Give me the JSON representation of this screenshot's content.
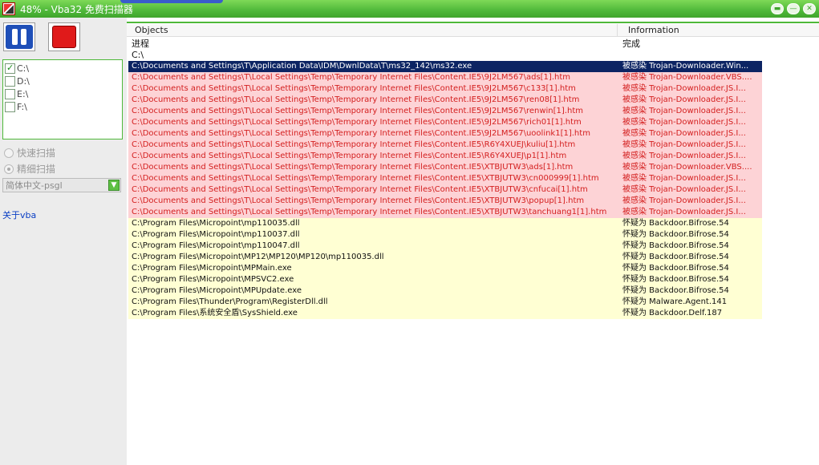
{
  "window": {
    "title": "48% - Vba32 免费扫描器"
  },
  "left": {
    "drives": [
      {
        "label": "C:\\",
        "checked": true
      },
      {
        "label": "D:\\",
        "checked": false
      },
      {
        "label": "E:\\",
        "checked": false
      },
      {
        "label": "F:\\",
        "checked": false
      }
    ],
    "quick_scan": "快速扫描",
    "deep_scan": "精细扫描",
    "language": "简体中文-psgl",
    "about": "关于vba"
  },
  "table": {
    "col_objects": "Objects",
    "col_info": "Information",
    "rows": [
      {
        "type": "plain",
        "object": "进程",
        "info": "完成"
      },
      {
        "type": "plain",
        "object": "C:\\",
        "info": ""
      },
      {
        "type": "selected",
        "object": "C:\\Documents and Settings\\T\\Application Data\\IDM\\DwnlData\\T\\ms32_142\\ms32.exe",
        "info": "被感染 Trojan-Downloader.Win..."
      },
      {
        "type": "infected",
        "object": "C:\\Documents and Settings\\T\\Local Settings\\Temp\\Temporary Internet Files\\Content.IE5\\9J2LM567\\ads[1].htm",
        "info": "被感染 Trojan-Downloader.VBS...."
      },
      {
        "type": "infected",
        "object": "C:\\Documents and Settings\\T\\Local Settings\\Temp\\Temporary Internet Files\\Content.IE5\\9J2LM567\\c133[1].htm",
        "info": "被感染 Trojan-Downloader.JS.I..."
      },
      {
        "type": "infected",
        "object": "C:\\Documents and Settings\\T\\Local Settings\\Temp\\Temporary Internet Files\\Content.IE5\\9J2LM567\\ren08[1].htm",
        "info": "被感染 Trojan-Downloader.JS.I..."
      },
      {
        "type": "infected",
        "object": "C:\\Documents and Settings\\T\\Local Settings\\Temp\\Temporary Internet Files\\Content.IE5\\9J2LM567\\renwin[1].htm",
        "info": "被感染 Trojan-Downloader.JS.I..."
      },
      {
        "type": "infected",
        "object": "C:\\Documents and Settings\\T\\Local Settings\\Temp\\Temporary Internet Files\\Content.IE5\\9J2LM567\\rich01[1].htm",
        "info": "被感染 Trojan-Downloader.JS.I..."
      },
      {
        "type": "infected",
        "object": "C:\\Documents and Settings\\T\\Local Settings\\Temp\\Temporary Internet Files\\Content.IE5\\9J2LM567\\uoolink1[1].htm",
        "info": "被感染 Trojan-Downloader.JS.I..."
      },
      {
        "type": "infected",
        "object": "C:\\Documents and Settings\\T\\Local Settings\\Temp\\Temporary Internet Files\\Content.IE5\\R6Y4XUEJ\\kuliu[1].htm",
        "info": "被感染 Trojan-Downloader.JS.I..."
      },
      {
        "type": "infected",
        "object": "C:\\Documents and Settings\\T\\Local Settings\\Temp\\Temporary Internet Files\\Content.IE5\\R6Y4XUEJ\\p1[1].htm",
        "info": "被感染 Trojan-Downloader.JS.I..."
      },
      {
        "type": "infected",
        "object": "C:\\Documents and Settings\\T\\Local Settings\\Temp\\Temporary Internet Files\\Content.IE5\\XTBJUTW3\\ads[1].htm",
        "info": "被感染 Trojan-Downloader.VBS...."
      },
      {
        "type": "infected",
        "object": "C:\\Documents and Settings\\T\\Local Settings\\Temp\\Temporary Internet Files\\Content.IE5\\XTBJUTW3\\cn000999[1].htm",
        "info": "被感染 Trojan-Downloader.JS.I..."
      },
      {
        "type": "infected",
        "object": "C:\\Documents and Settings\\T\\Local Settings\\Temp\\Temporary Internet Files\\Content.IE5\\XTBJUTW3\\cnfucai[1].htm",
        "info": "被感染 Trojan-Downloader.JS.I..."
      },
      {
        "type": "infected",
        "object": "C:\\Documents and Settings\\T\\Local Settings\\Temp\\Temporary Internet Files\\Content.IE5\\XTBJUTW3\\popup[1].htm",
        "info": "被感染 Trojan-Downloader.JS.I..."
      },
      {
        "type": "infected",
        "object": "C:\\Documents and Settings\\T\\Local Settings\\Temp\\Temporary Internet Files\\Content.IE5\\XTBJUTW3\\tanchuang1[1].htm",
        "info": "被感染 Trojan-Downloader.JS.I..."
      },
      {
        "type": "suspect",
        "object": "C:\\Program Files\\Micropoint\\mp110035.dll",
        "info": "怀疑为 Backdoor.Bifrose.54"
      },
      {
        "type": "suspect",
        "object": "C:\\Program Files\\Micropoint\\mp110037.dll",
        "info": "怀疑为 Backdoor.Bifrose.54"
      },
      {
        "type": "suspect",
        "object": "C:\\Program Files\\Micropoint\\mp110047.dll",
        "info": "怀疑为 Backdoor.Bifrose.54"
      },
      {
        "type": "suspect",
        "object": "C:\\Program Files\\Micropoint\\MP12\\MP120\\MP120\\mp110035.dll",
        "info": "怀疑为 Backdoor.Bifrose.54"
      },
      {
        "type": "suspect",
        "object": "C:\\Program Files\\Micropoint\\MPMain.exe",
        "info": "怀疑为 Backdoor.Bifrose.54"
      },
      {
        "type": "suspect",
        "object": "C:\\Program Files\\Micropoint\\MPSVC2.exe",
        "info": "怀疑为 Backdoor.Bifrose.54"
      },
      {
        "type": "suspect",
        "object": "C:\\Program Files\\Micropoint\\MPUpdate.exe",
        "info": "怀疑为 Backdoor.Bifrose.54"
      },
      {
        "type": "suspect",
        "object": "C:\\Program Files\\Thunder\\Program\\RegisterDll.dll",
        "info": "怀疑为 Malware.Agent.141"
      },
      {
        "type": "suspect",
        "object": "C:\\Program Files\\系统安全盾\\SysShield.exe",
        "info": "怀疑为 Backdoor.Delf.187"
      }
    ]
  }
}
